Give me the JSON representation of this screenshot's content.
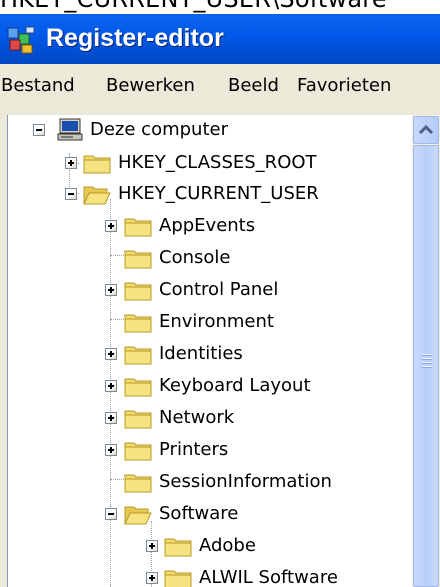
{
  "cut_top_text": "HKEY_CURRENT_USER\\Software",
  "window": {
    "title": "Register-editor"
  },
  "menu": [
    "Bestand",
    "Bewerken",
    "Beeld",
    "Favorieten"
  ],
  "tree": {
    "root": "Deze computer",
    "hives": [
      "HKEY_CLASSES_ROOT",
      "HKEY_CURRENT_USER"
    ],
    "hkcu_children": [
      "AppEvents",
      "Console",
      "Control Panel",
      "Environment",
      "Identities",
      "Keyboard Layout",
      "Network",
      "Printers",
      "SessionInformation",
      "Software"
    ],
    "software_children": [
      "Adobe",
      "ALWIL Software"
    ]
  },
  "colors": {
    "titlebar": "#0058e8",
    "menubar": "#ece9d8",
    "folder": "#f0d86a",
    "scrollbar": "#b8cffb"
  }
}
